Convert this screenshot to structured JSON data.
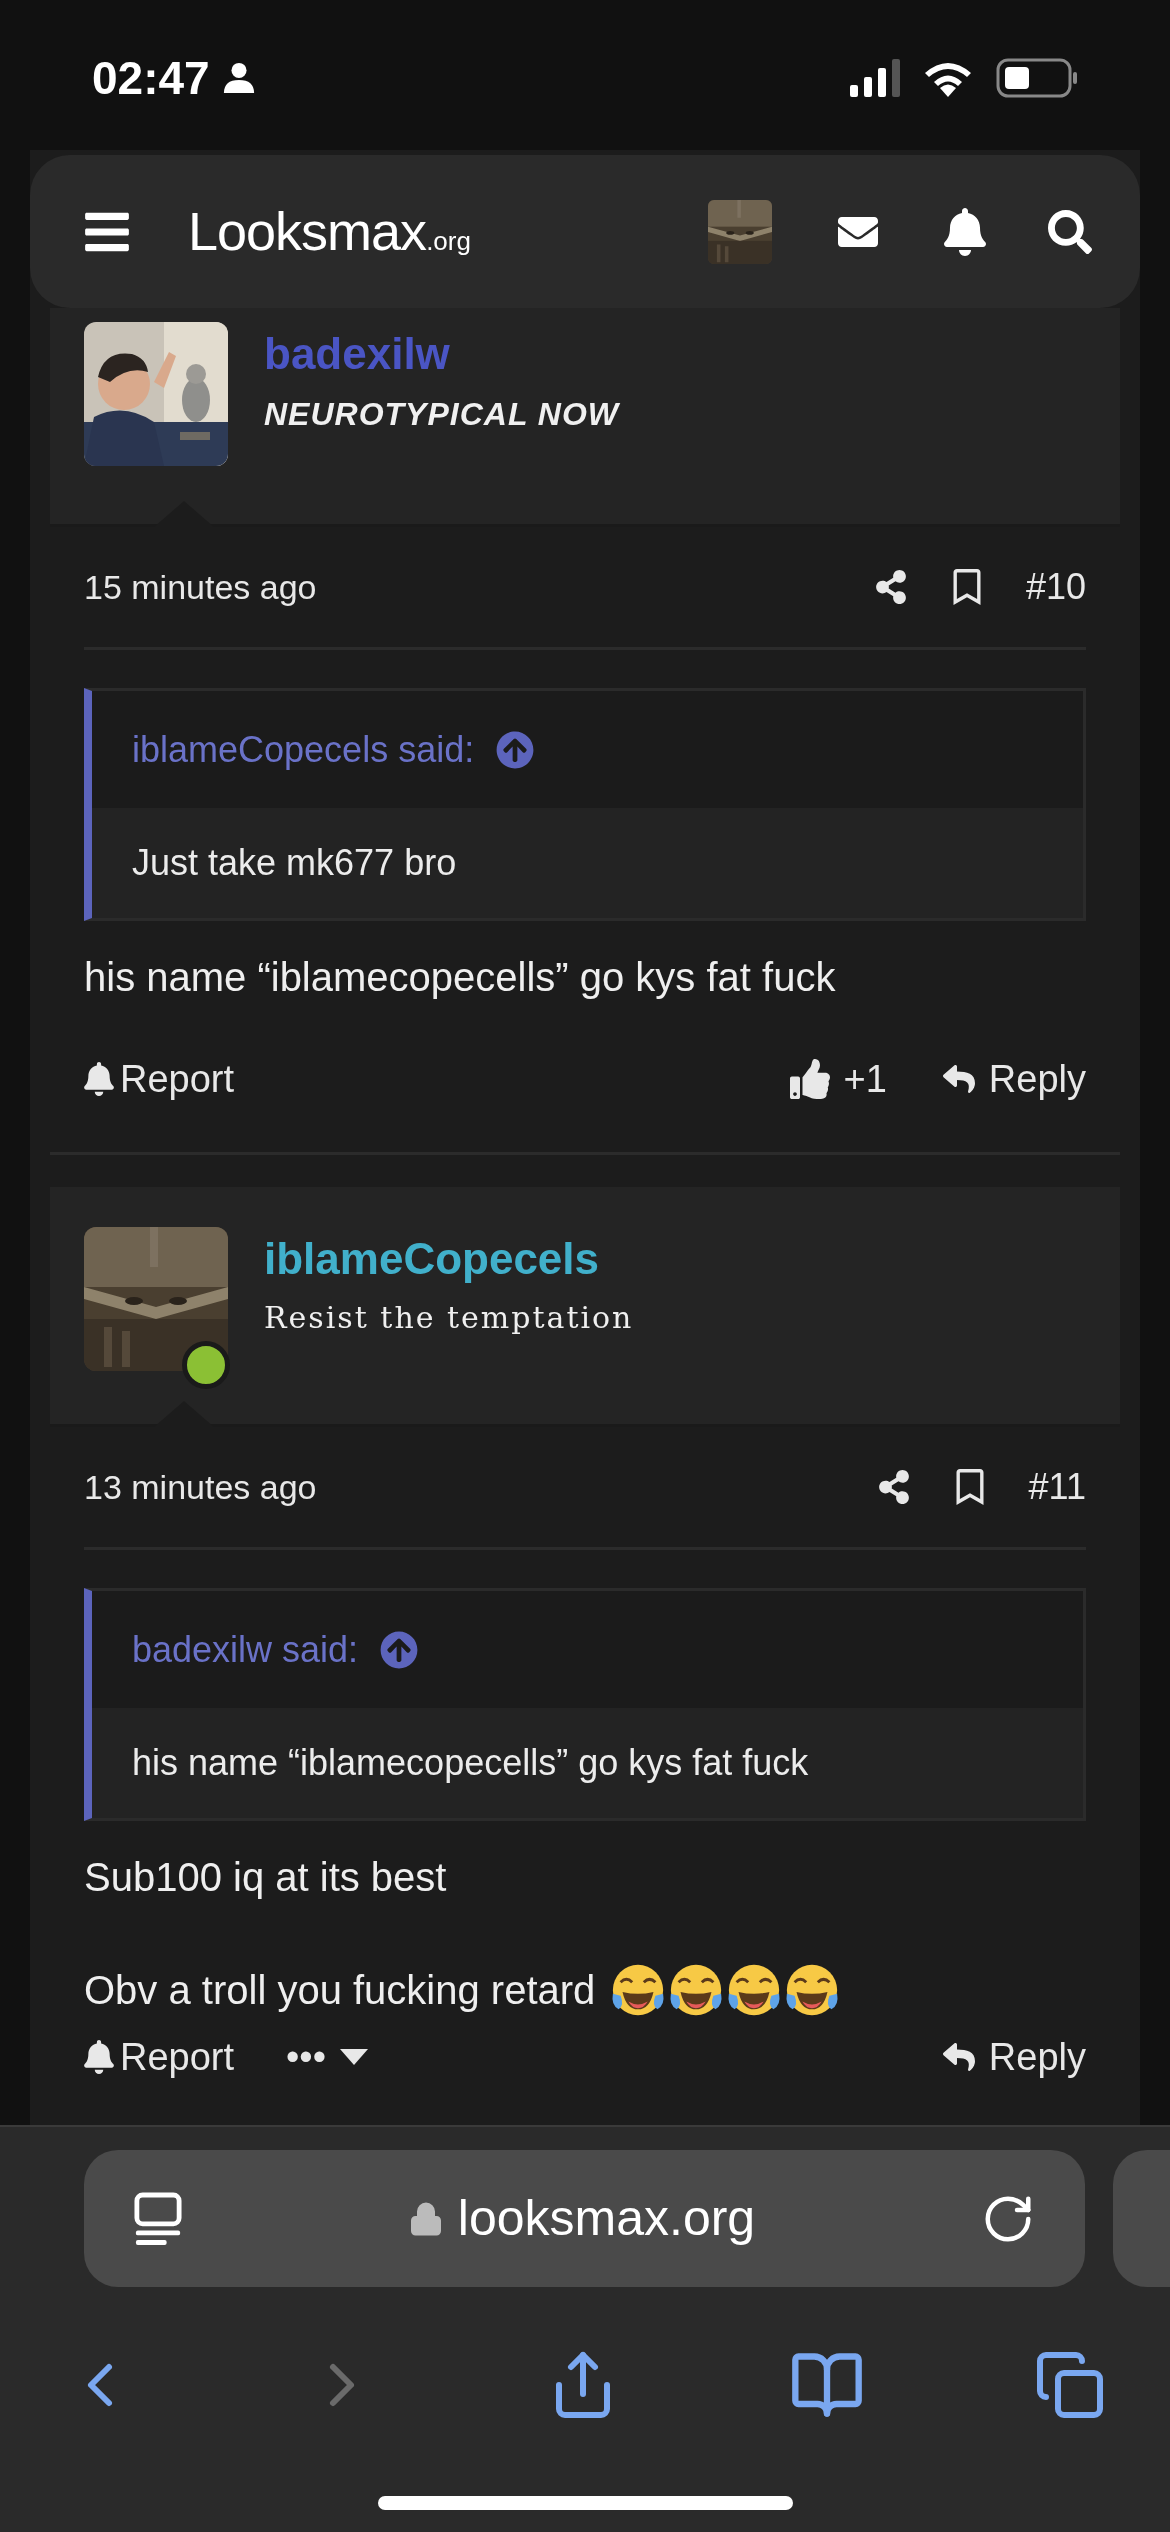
{
  "status_bar": {
    "time": "02:47"
  },
  "header": {
    "logo": {
      "name": "Looksmax",
      "suffix": ".org"
    }
  },
  "posts": [
    {
      "username": "badexilw",
      "user_title": "NEUROTYPICAL NOW",
      "kind": "italic",
      "color": "#4a55c4",
      "online": false,
      "time": "15 minutes ago",
      "number": "#10",
      "quote": {
        "attribution": "iblameCopecels said:",
        "text": "Just take mk677 bro"
      },
      "body": [
        "his name “iblamecopecells” go kys fat fuck"
      ],
      "actions": [
        {
          "kind": "report",
          "label": "Report"
        },
        {
          "kind": "like",
          "label": "+1"
        },
        {
          "kind": "reply",
          "label": "Reply"
        }
      ]
    },
    {
      "username": "iblameCopecels",
      "user_title": "Resist the temptation",
      "kind": "blackletter",
      "color": "#41b0cb",
      "online": true,
      "time": "13 minutes ago",
      "number": "#11",
      "quote": {
        "attribution": "badexilw said:",
        "text": "his name “iblamecopecells” go kys fat fuck"
      },
      "body": [
        "Sub100 iq at its best",
        "Obv a troll you fucking retard"
      ],
      "reactions": [
        {
          "kind": "tears-of-joy"
        },
        {
          "kind": "tears-of-joy"
        },
        {
          "kind": "tears-of-joy"
        },
        {
          "kind": "tears-of-joy"
        }
      ],
      "actions": [
        {
          "kind": "report",
          "label": "Report"
        },
        {
          "kind": "more",
          "label": "•••"
        },
        {
          "kind": "reply",
          "label": "Reply"
        }
      ]
    }
  ],
  "browser": {
    "url": "looksmax.org",
    "nav": [
      {
        "kind": "back",
        "disabled": false
      },
      {
        "kind": "forward",
        "disabled": true
      },
      {
        "kind": "share",
        "disabled": false
      },
      {
        "kind": "bookmarks",
        "disabled": false
      },
      {
        "kind": "tabs",
        "disabled": false
      }
    ]
  }
}
